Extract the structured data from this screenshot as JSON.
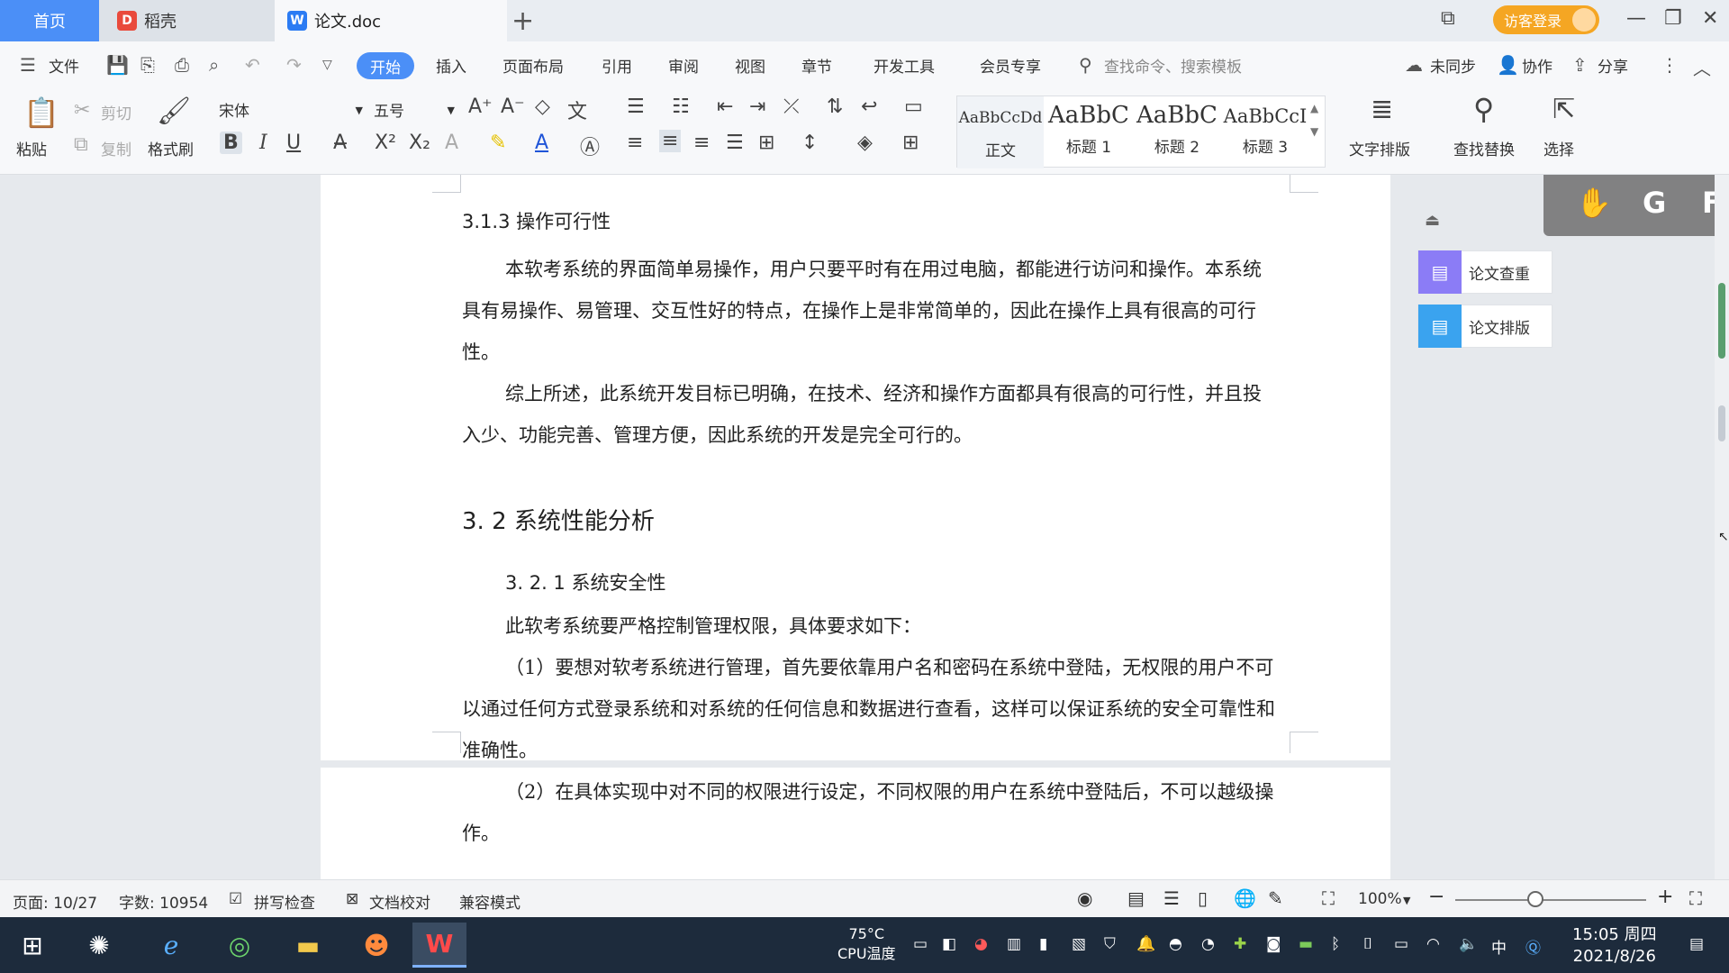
{
  "tabs": {
    "home": "首页",
    "daoke": "稻壳",
    "doc": "论文.doc",
    "add": "+"
  },
  "titlebar": {
    "guest_login": "访客登录"
  },
  "menu": {
    "file": "文件",
    "items": [
      "开始",
      "插入",
      "页面布局",
      "引用",
      "审阅",
      "视图",
      "章节",
      "开发工具",
      "会员专享"
    ],
    "search_cmd": "查找命令、搜索模板",
    "unsync": "未同步",
    "collab": "协作",
    "share": "分享"
  },
  "ribbon": {
    "paste": "粘贴",
    "cut": "剪切",
    "copy": "复制",
    "format_painter": "格式刷",
    "font_name": "宋体",
    "font_size": "五号",
    "styles": [
      {
        "sample": "AaBbCcDd",
        "label": "正文"
      },
      {
        "sample": "AaBbC",
        "label": "标题 1"
      },
      {
        "sample": "AaBbC",
        "label": "标题 2"
      },
      {
        "sample": "AaBbCcI",
        "label": "标题 3"
      }
    ],
    "text_layout": "文字排版",
    "find_replace": "查找替换",
    "select": "选择"
  },
  "document": {
    "h_313": "3.1.3 操作可行性",
    "p1": "本软考系统的界面简单易操作，用户只要平时有在用过电脑，都能进行访问和操作。本系统具有易操作、易管理、交互性好的特点，在操作上是非常简单的，因此在操作上具有很高的可行性。",
    "p2": "综上所述，此系统开发目标已明确，在技术、经济和操作方面都具有很高的可行性，并且投入少、功能完善、管理方便，因此系统的开发是完全可行的。",
    "h_32": "3. 2 系统性能分析",
    "h_321": "3. 2. 1  系统安全性",
    "p3": "此软考系统要严格控制管理权限，具体要求如下：",
    "p4": "（1）要想对软考系统进行管理，首先要依靠用户名和密码在系统中登陆，无权限的用户不可以通过任何方式登录系统和对系统的任何信息和数据进行查看，这样可以保证系统的安全可靠性和准确性。",
    "p5": "（2）在具体实现中对不同的权限进行设定，不同权限的用户在系统中登陆后，不可以越级操作。"
  },
  "side_panel": {
    "check": "论文查重",
    "layout": "论文排版",
    "float_letters": [
      "G",
      "F"
    ]
  },
  "status": {
    "page": "页面: 10/27",
    "words": "字数: 10954",
    "spell": "拼写检查",
    "proofread": "文档校对",
    "compat": "兼容模式",
    "zoom": "100%",
    "zoom_level": 0.42
  },
  "taskbar": {
    "cpu_temp": "75°C",
    "cpu_label": "CPU温度",
    "ime": "中",
    "time": "15:05 周四",
    "date": "2021/8/26"
  },
  "colors": {
    "accent": "#4b8ff7",
    "guest": "#f5a623",
    "taskbar": "#1d2b3c"
  }
}
